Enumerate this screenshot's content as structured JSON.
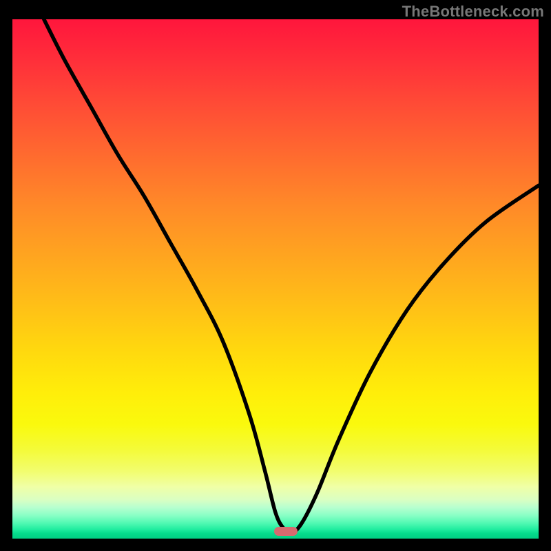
{
  "watermark": "TheBottleneck.com",
  "chart_data": {
    "type": "line",
    "title": "",
    "xlabel": "",
    "ylabel": "",
    "xlim": [
      0,
      100
    ],
    "ylim": [
      0,
      100
    ],
    "legend": false,
    "grid": false,
    "background": "vertical gradient red→yellow→green (percent mismatch heatmap)",
    "series": [
      {
        "name": "bottleneck-curve",
        "x": [
          6,
          10,
          15,
          20,
          25,
          30,
          35,
          40,
          45,
          48,
          50,
          51.5,
          53,
          55,
          58,
          62,
          68,
          75,
          82,
          90,
          100
        ],
        "y": [
          100,
          92,
          83,
          74,
          66,
          57,
          48,
          38,
          24,
          13,
          5,
          2,
          1,
          3,
          9,
          19,
          32,
          44,
          53,
          61,
          68
        ],
        "color": "#000000"
      }
    ],
    "annotations": [
      {
        "name": "optimal-marker",
        "x": 52,
        "y": 1.5,
        "shape": "pill",
        "color": "#d66a6f"
      }
    ]
  }
}
